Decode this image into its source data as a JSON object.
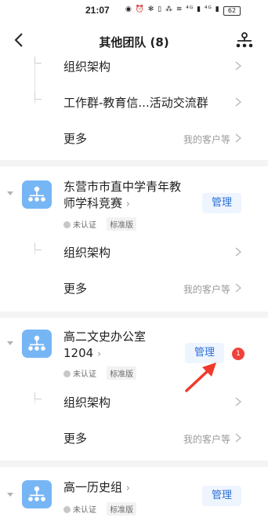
{
  "status": {
    "time": "21:07",
    "icons": "◉ ⏰ ✻ ▯ ⁂ ≋ ⁴ᴳ ▮ ⁴ᴳ ▮",
    "battery": "62"
  },
  "nav": {
    "title": "其他团队 (8)"
  },
  "rows_top": [
    {
      "label": "组织架构",
      "hint": ""
    },
    {
      "label": "工作群-教育信...活动交流群",
      "hint": ""
    },
    {
      "label": "更多",
      "hint": "我的客户等"
    }
  ],
  "teams": [
    {
      "name_line1": "东营市市直中学青年教",
      "name_line2": "师学科竞赛",
      "chevron": "›",
      "tag_unverified": "未认证",
      "tag_edition": "标准版",
      "manage": "管理",
      "rows": [
        {
          "label": "组织架构",
          "hint": ""
        },
        {
          "label": "更多",
          "hint": "我的客户等"
        }
      ]
    },
    {
      "name_line1": "高二文史办公室",
      "name_line2": "1204",
      "chevron": "›",
      "tag_unverified": "未认证",
      "tag_edition": "标准版",
      "manage": "管理",
      "badge": "1",
      "rows": [
        {
          "label": "组织架构",
          "hint": ""
        },
        {
          "label": "更多",
          "hint": "我的客户等"
        }
      ]
    },
    {
      "name_line1": "高一历史组",
      "name_line2": "",
      "chevron": "›",
      "tag_unverified": "未认证",
      "tag_edition": "标准版",
      "manage": "管理"
    }
  ],
  "colors": {
    "accent": "#2d6fd6",
    "avatar": "#77b6f5",
    "badge": "#f0423a",
    "arrow": "#ef3b2d"
  }
}
